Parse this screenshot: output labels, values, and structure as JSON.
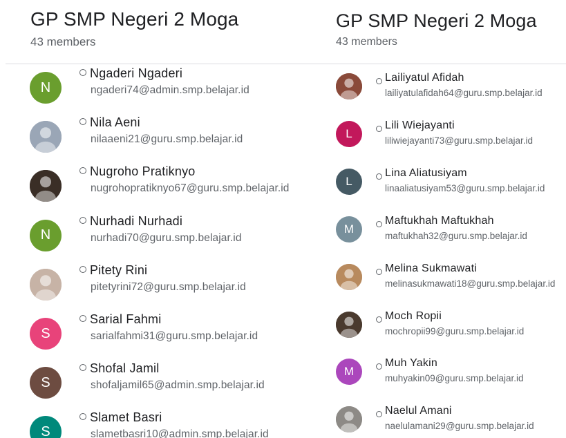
{
  "left_panel": {
    "group_title": "GP SMP Negeri 2 Moga",
    "member_count": "43 members",
    "members": [
      {
        "name": "Ngaderi Ngaderi",
        "email": "ngaderi74@admin.smp.belajar.id",
        "avatar_letter": "N",
        "avatar_color": "#6a9e2e",
        "avatar_type": "letter"
      },
      {
        "name": "Nila Aeni",
        "email": "nilaaeni21@guru.smp.belajar.id",
        "avatar_letter": "",
        "avatar_color": "#9aa6b6",
        "avatar_type": "photo"
      },
      {
        "name": "Nugroho Pratiknyo",
        "email": "nugrohopratiknyo67@guru.smp.belajar.id",
        "avatar_letter": "",
        "avatar_color": "#3a2e26",
        "avatar_type": "photo"
      },
      {
        "name": "Nurhadi Nurhadi",
        "email": "nurhadi70@guru.smp.belajar.id",
        "avatar_letter": "N",
        "avatar_color": "#6a9e2e",
        "avatar_type": "letter"
      },
      {
        "name": "Pitety Rini",
        "email": "pitetyrini72@guru.smp.belajar.id",
        "avatar_letter": "",
        "avatar_color": "#c7b3a6",
        "avatar_type": "photo"
      },
      {
        "name": "Sarial Fahmi",
        "email": "sarialfahmi31@guru.smp.belajar.id",
        "avatar_letter": "S",
        "avatar_color": "#e8437a",
        "avatar_type": "letter"
      },
      {
        "name": "Shofal Jamil",
        "email": "shofaljamil65@admin.smp.belajar.id",
        "avatar_letter": "S",
        "avatar_color": "#6d4c41",
        "avatar_type": "letter"
      },
      {
        "name": "Slamet Basri",
        "email": "slametbasri10@admin.smp.belajar.id",
        "avatar_letter": "S",
        "avatar_color": "#00897b",
        "avatar_type": "letter"
      }
    ]
  },
  "right_panel": {
    "group_title": "GP SMP Negeri 2 Moga",
    "member_count": "43 members",
    "members": [
      {
        "name": "Lailiyatul Afidah",
        "email": "lailiyatulafidah64@guru.smp.belajar.id",
        "avatar_letter": "",
        "avatar_color": "#8a4a3a",
        "avatar_type": "photo"
      },
      {
        "name": "Lili Wiejayanti",
        "email": "liliwiejayanti73@guru.smp.belajar.id",
        "avatar_letter": "L",
        "avatar_color": "#c2185b",
        "avatar_type": "letter"
      },
      {
        "name": "Lina Aliatusiyam",
        "email": "linaaliatusiyam53@guru.smp.belajar.id",
        "avatar_letter": "L",
        "avatar_color": "#455a64",
        "avatar_type": "letter"
      },
      {
        "name": "Maftukhah Maftukhah",
        "email": "maftukhah32@guru.smp.belajar.id",
        "avatar_letter": "M",
        "avatar_color": "#78909c",
        "avatar_type": "letter"
      },
      {
        "name": "Melina Sukmawati",
        "email": "melinasukmawati18@guru.smp.belajar.id",
        "avatar_letter": "",
        "avatar_color": "#b88a5e",
        "avatar_type": "photo"
      },
      {
        "name": "Moch Ropii",
        "email": "mochropii99@guru.smp.belajar.id",
        "avatar_letter": "",
        "avatar_color": "#4a3a2e",
        "avatar_type": "photo"
      },
      {
        "name": "Muh Yakin",
        "email": "muhyakin09@guru.smp.belajar.id",
        "avatar_letter": "M",
        "avatar_color": "#ab47bc",
        "avatar_type": "letter"
      },
      {
        "name": "Naelul Amani",
        "email": "naelulamani29@guru.smp.belajar.id",
        "avatar_letter": "",
        "avatar_color": "#8d8a86",
        "avatar_type": "photo"
      }
    ]
  }
}
